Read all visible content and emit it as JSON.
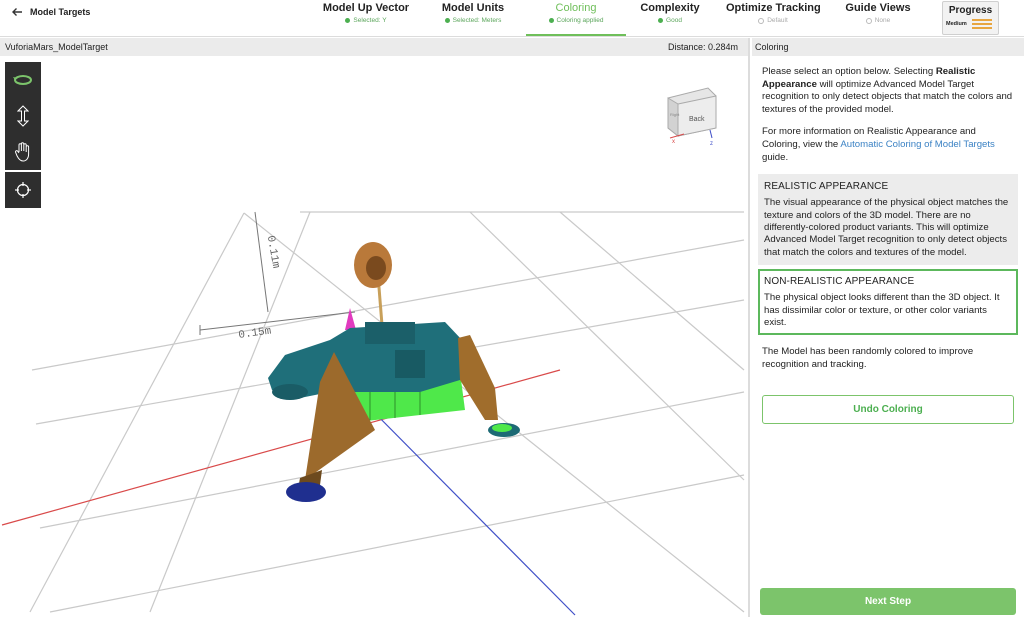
{
  "header": {
    "back_label": "Model Targets",
    "steps": [
      {
        "label": "Model Up Vector",
        "status": "Selected: Y"
      },
      {
        "label": "Model Units",
        "status": "Selected: Meters"
      },
      {
        "label": "Coloring",
        "status": "Coloring applied"
      },
      {
        "label": "Complexity",
        "status": "Good"
      },
      {
        "label": "Optimize Tracking",
        "status": "Default"
      },
      {
        "label": "Guide Views",
        "status": "None"
      }
    ],
    "progress": {
      "label": "Progress",
      "level": "Medium"
    }
  },
  "viewport": {
    "title": "VuforiaMars_ModelTarget",
    "distance": "Distance:  0.284m",
    "tools": [
      "rotate-icon",
      "vertical-move-icon",
      "pan-hand-icon",
      "target-crosshair-icon"
    ],
    "dimension_label": "0.15m",
    "vertical_label": "0.11m",
    "cube_face": "Back",
    "cube_side_label": "Right",
    "axis_x": "x",
    "axis_z": "z"
  },
  "panel": {
    "title": "Coloring",
    "intro1_a": "Please select an option below. Selecting ",
    "intro1_bold": "Realistic Appearance",
    "intro1_b": " will optimize Advanced Model Target recognition to only detect objects that match the colors and textures of the provided model.",
    "intro2_a": "For more information on Realistic Appearance and Coloring, view the ",
    "intro2_link": "Automatic Coloring of Model Targets",
    "intro2_b": " guide.",
    "options": [
      {
        "title": "REALISTIC APPEARANCE",
        "body": "The visual appearance of the physical object matches the texture and colors of the 3D model. There are no differently-colored product variants. This will optimize Advanced Model Target recognition to only detect objects that match the colors and textures of the model."
      },
      {
        "title": "NON-REALISTIC APPEARANCE",
        "body": "The physical object looks different than the 3D object. It has dissimilar color or texture, or other color variants exist."
      }
    ],
    "note": "The Model has been randomly colored to improve recognition and tracking.",
    "undo_label": "Undo Coloring",
    "next_label": "Next Step"
  },
  "colors": {
    "accent": "#6fbf5a",
    "link": "#3b82c4",
    "progress": "#e8a640"
  }
}
